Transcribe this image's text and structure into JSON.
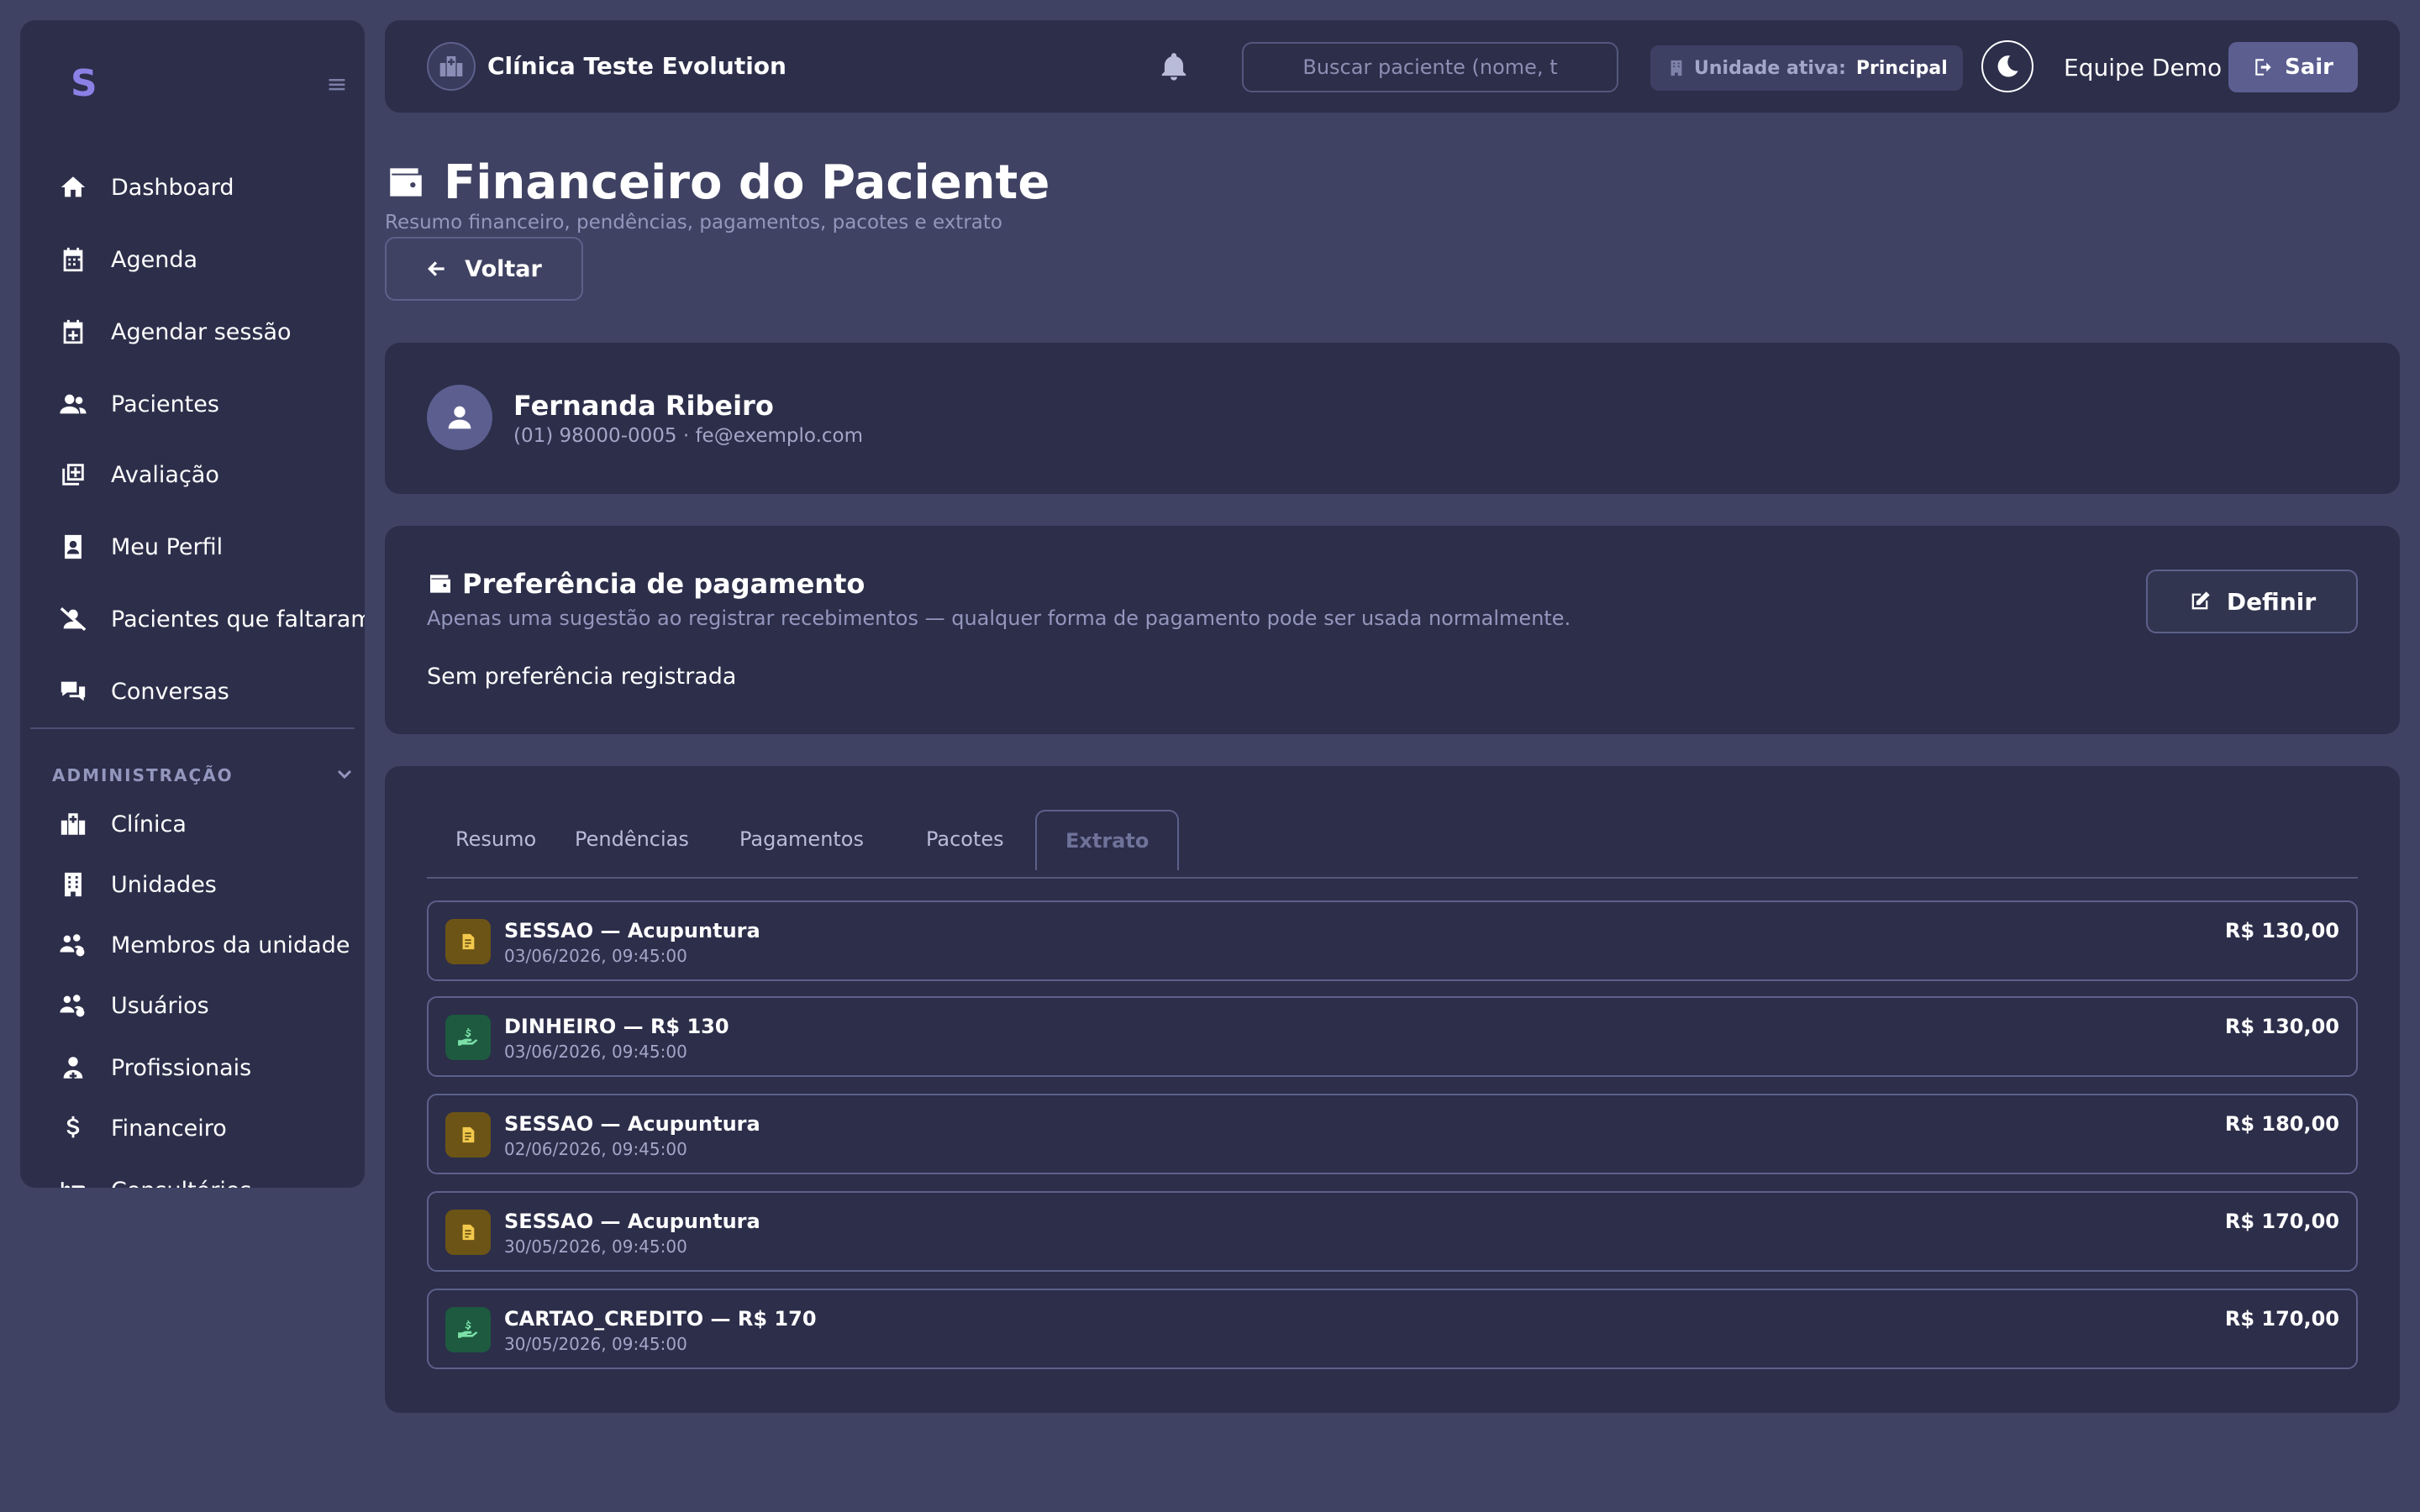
{
  "sidebar": {
    "nav": [
      {
        "label": "Dashboard",
        "icon": "home-icon"
      },
      {
        "label": "Agenda",
        "icon": "calendar-icon"
      },
      {
        "label": "Agendar sessão",
        "icon": "calendar-plus-icon"
      },
      {
        "label": "Pacientes",
        "icon": "users-icon"
      },
      {
        "label": "Avaliação",
        "icon": "notes-plus-icon"
      },
      {
        "label": "Meu Perfil",
        "icon": "id-badge-icon"
      },
      {
        "label": "Pacientes que faltaram",
        "icon": "user-slash-icon"
      },
      {
        "label": "Conversas",
        "icon": "comments-icon"
      }
    ],
    "admin_section_label": "ADMINISTRAÇÃO",
    "admin": [
      {
        "label": "Clínica",
        "icon": "hospital-icon"
      },
      {
        "label": "Unidades",
        "icon": "building-icon"
      },
      {
        "label": "Membros da unidade",
        "icon": "users-gear-icon"
      },
      {
        "label": "Usuários",
        "icon": "users-gear-icon"
      },
      {
        "label": "Profissionais",
        "icon": "user-doctor-icon"
      },
      {
        "label": "Financeiro",
        "icon": "dollar-icon"
      },
      {
        "label": "Consultórios",
        "icon": "bed-icon"
      }
    ]
  },
  "header": {
    "clinic_name": "Clínica Teste Evolution",
    "search_placeholder": "Buscar paciente (nome, t",
    "unit_label": "Unidade ativa:",
    "unit_value": "Principal",
    "user_name": "Equipe Demo",
    "logout_label": "Sair"
  },
  "page": {
    "title": "Financeiro do Paciente",
    "subtitle": "Resumo financeiro, pendências, pagamentos, pacotes e extrato",
    "back_label": "Voltar"
  },
  "patient": {
    "name": "Fernanda Ribeiro",
    "contact": "(01) 98000-0005 · fe@exemplo.com"
  },
  "preference": {
    "title": "Preferência de pagamento",
    "description": "Apenas uma sugestão ao registrar recebimentos — qualquer forma de pagamento pode ser usada normalmente.",
    "value": "Sem preferência registrada",
    "define_label": "Definir"
  },
  "tabs": [
    "Resumo",
    "Pendências",
    "Pagamentos",
    "Pacotes",
    "Extrato"
  ],
  "active_tab": "Extrato",
  "ledger": [
    {
      "kind": "session",
      "title": "SESSAO — Acupuntura",
      "date": "03/06/2026, 09:45:00",
      "amount": "R$ 130,00"
    },
    {
      "kind": "payment",
      "title": "DINHEIRO — R$ 130",
      "date": "03/06/2026, 09:45:00",
      "amount": "R$ 130,00"
    },
    {
      "kind": "session",
      "title": "SESSAO — Acupuntura",
      "date": "02/06/2026, 09:45:00",
      "amount": "R$ 180,00"
    },
    {
      "kind": "session",
      "title": "SESSAO — Acupuntura",
      "date": "30/05/2026, 09:45:00",
      "amount": "R$ 170,00"
    },
    {
      "kind": "payment",
      "title": "CARTAO_CREDITO — R$ 170",
      "date": "30/05/2026, 09:45:00",
      "amount": "R$ 170,00"
    }
  ],
  "colors": {
    "background": "#3f4262",
    "panel": "#2c2e4a",
    "accent": "#5b5e8f",
    "session_icon_bg": "#6c5416",
    "payment_icon_bg": "#1d5a3f"
  }
}
